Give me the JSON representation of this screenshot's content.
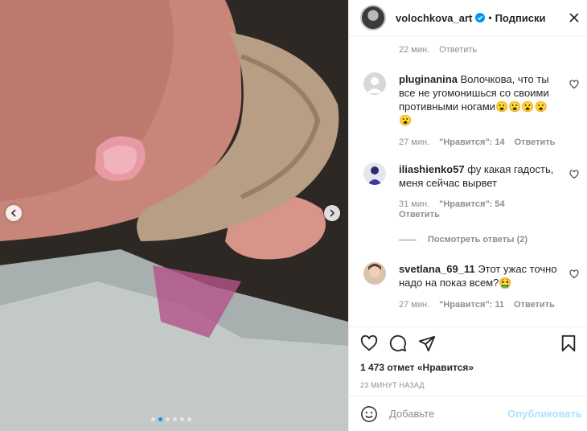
{
  "header": {
    "username": "volochkova_art",
    "separator": "•",
    "follow_label": "Подписки"
  },
  "comments": {
    "top_meta": {
      "time": "22 мин.",
      "reply": "Ответить"
    },
    "items": [
      {
        "username": "pluginanina",
        "text": " Волочкова, что ты все не угомонишься со своими противными ногами😮😮😮😮😮",
        "time": "27 мин.",
        "likes": "\"Нравится\": 14",
        "reply": "Ответить"
      },
      {
        "username": "iliashienko57",
        "text": " фу какая гадость, меня сейчас вырвет",
        "time": "31 мин.",
        "likes": "\"Нравится\": 54",
        "reply": "Ответить"
      },
      {
        "username": "svetlana_69_11",
        "text": " Этот ужас точно надо на показ всем?🤮",
        "time": "27 мин.",
        "likes": "\"Нравится\": 11",
        "reply": "Ответить"
      }
    ],
    "view_replies": "Посмотреть ответы (2)"
  },
  "post": {
    "likes": "1 473 отмет «Нравится»",
    "timestamp": "23 минут назад"
  },
  "add_comment": {
    "placeholder": "Добавьте",
    "publish_label": "Опубликовать"
  },
  "carousel": {
    "slide_count": 6,
    "active_index": 1
  },
  "colors": {
    "accent": "#0095f6",
    "verified": "#0095f6",
    "publish_disabled": "#b2dffc",
    "muted": "#8e8e8e"
  }
}
